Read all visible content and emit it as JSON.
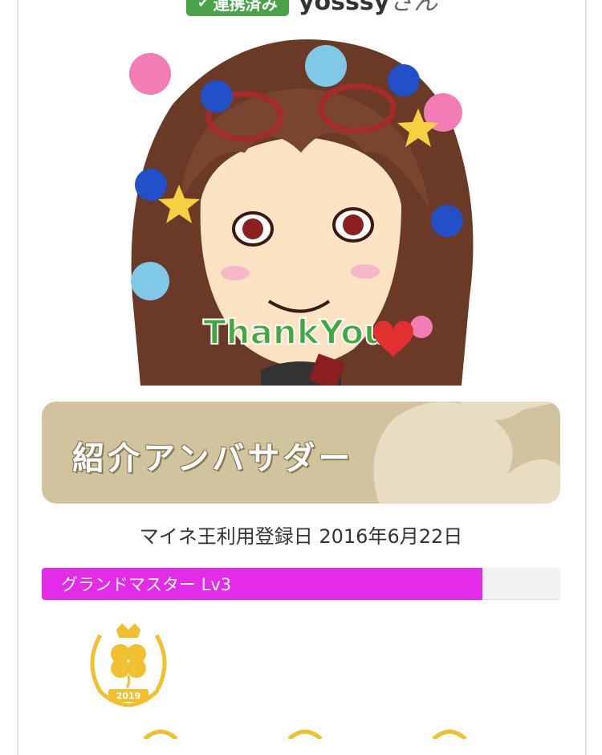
{
  "header": {
    "linked_badge": "連携済み",
    "username": "yosssy",
    "honorific": "さん"
  },
  "avatar": {
    "caption": "ThankYou"
  },
  "banner": {
    "title": "紹介アンバサダー"
  },
  "registration": {
    "text": "マイネ王利用登録日 2016年6月22日"
  },
  "level": {
    "label": "グランドマスター Lv3",
    "progress_percent": 85
  },
  "award": {
    "year": "2019"
  },
  "colors": {
    "linked_green": "#4aa34a",
    "level_magenta": "#e22ce8",
    "banner_tan": "#d2c39f",
    "award_gold": "#f0c030"
  }
}
